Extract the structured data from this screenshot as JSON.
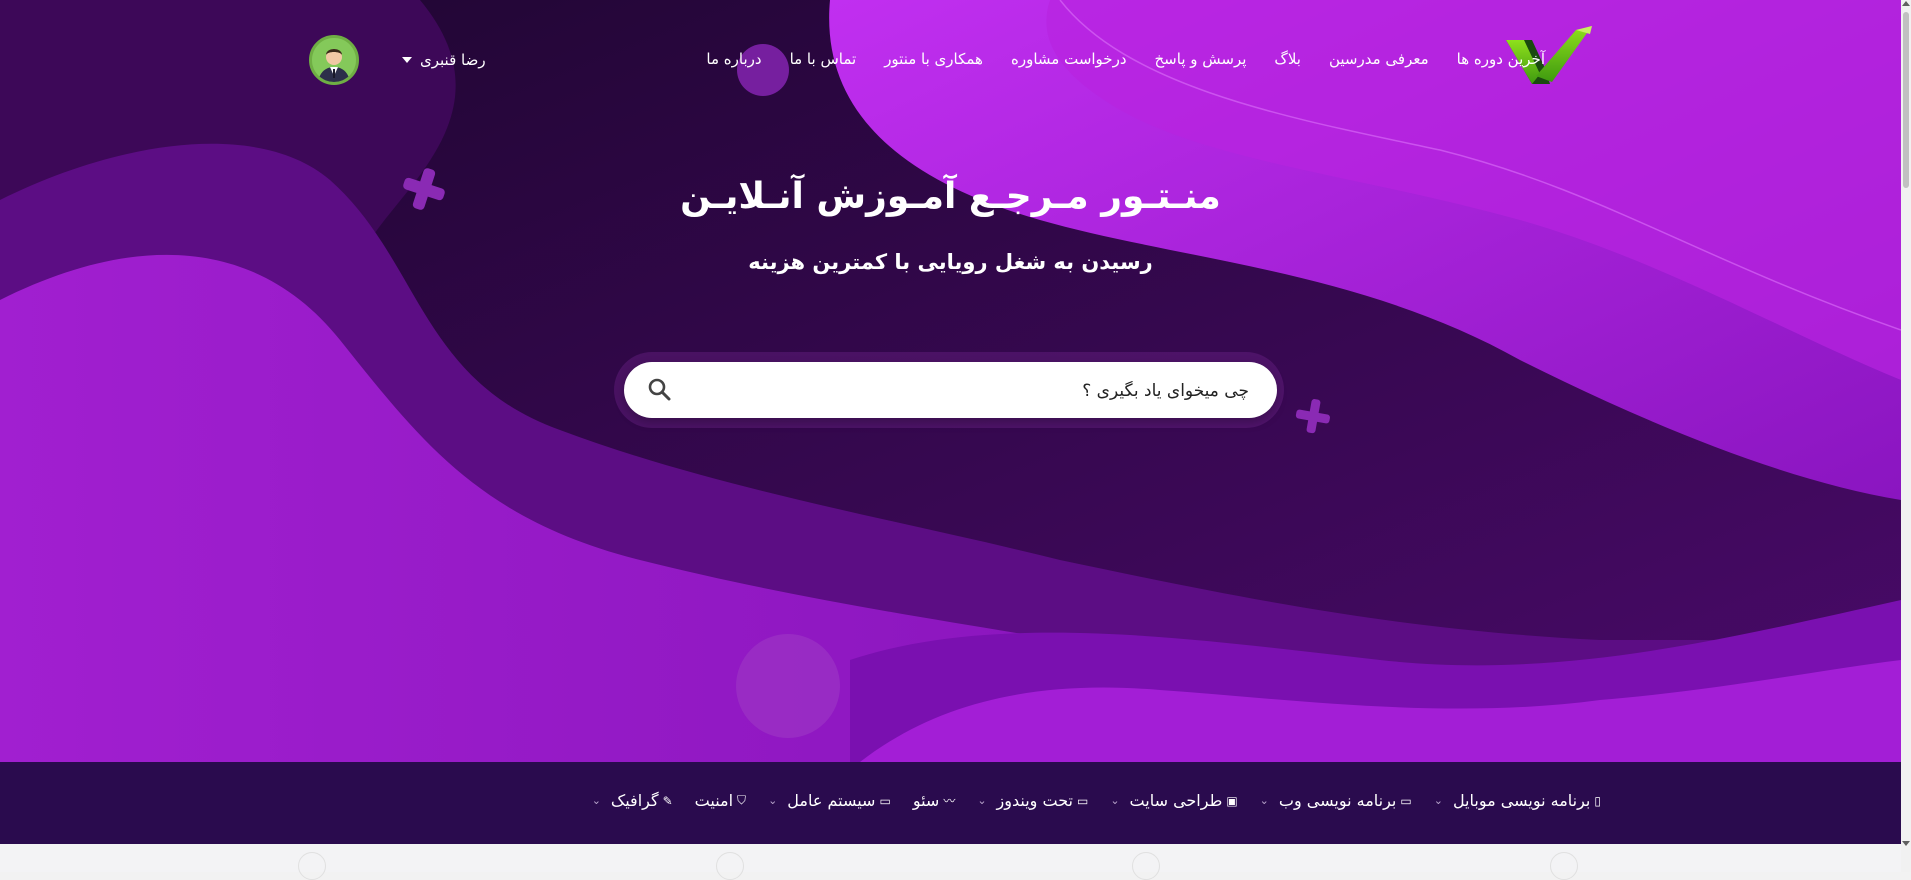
{
  "colors": {
    "hero_dark": "#2a0540",
    "hero_mid": "#5a0c82",
    "hero_light": "#c026e8",
    "category_bar": "#2a0b4e",
    "logo_green": "#8fe01c"
  },
  "header": {
    "logo": {
      "icon": "checkmark-logo-icon"
    },
    "nav_items": [
      "آخرین دوره ها",
      "معرفی مدرسین",
      "بلاگ",
      "پرسش و پاسخ",
      "درخواست مشاوره",
      "همکاری با منتور",
      "تماس با ما",
      "درباره ما"
    ],
    "user": {
      "name": "رضا قنبری",
      "icon": "chevron-down-icon"
    }
  },
  "hero": {
    "title": "منـتـور مـرجـع آمـوزش آنـلایـن",
    "subtitle": "رسیدن به شغل رویایی با کمترین هزینه"
  },
  "search": {
    "value": "",
    "placeholder": "چی میخوای یاد بگیری ؟",
    "icon": "search-icon"
  },
  "categories": [
    {
      "label": "برنامه نویسی موبایل",
      "icon": "mobile-icon",
      "glyph": "▯"
    },
    {
      "label": "برنامه نویسی وب",
      "icon": "laptop-icon",
      "glyph": "▭"
    },
    {
      "label": "طراحی سایت",
      "icon": "html5-icon",
      "glyph": "▣"
    },
    {
      "label": "تحت ویندوز",
      "icon": "desktop-icon",
      "glyph": "▭"
    },
    {
      "label": "سئو",
      "icon": "chart-line-icon",
      "glyph": "〰"
    },
    {
      "label": "سیستم عامل",
      "icon": "laptop-code-icon",
      "glyph": "▭"
    },
    {
      "label": "امنیت",
      "icon": "shield-icon",
      "glyph": "⛉"
    },
    {
      "label": "گرافیک",
      "icon": "brush-icon",
      "glyph": "✎"
    }
  ]
}
